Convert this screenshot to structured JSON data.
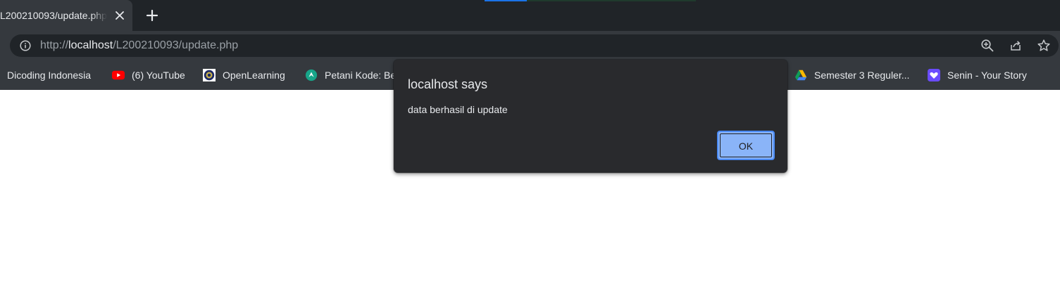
{
  "tabs": [
    {
      "title": "L200210093/update.php",
      "active": true
    }
  ],
  "address_bar": {
    "scheme": "http://",
    "host": "localhost",
    "path": "/L200210093/update.php"
  },
  "bookmarks": [
    {
      "label": "Dicoding Indonesia",
      "icon": "none"
    },
    {
      "label": "(6) YouTube",
      "icon": "youtube-icon"
    },
    {
      "label": "OpenLearning",
      "icon": "openlearning-icon"
    },
    {
      "label": "Petani Kode: Be",
      "icon": "petanikode-icon"
    },
    {
      "label": "Semester 3 Reguler...",
      "icon": "google-drive-icon"
    },
    {
      "label": "Senin - Your Story",
      "icon": "heart-icon"
    }
  ],
  "dialog": {
    "title": "localhost says",
    "message": "data berhasil di update",
    "ok_label": "OK"
  },
  "colors": {
    "tabstrip": "#202428",
    "toolbar": "#35393e",
    "dialog_bg": "#292a2d",
    "ok_button": "#8ab4f8"
  }
}
